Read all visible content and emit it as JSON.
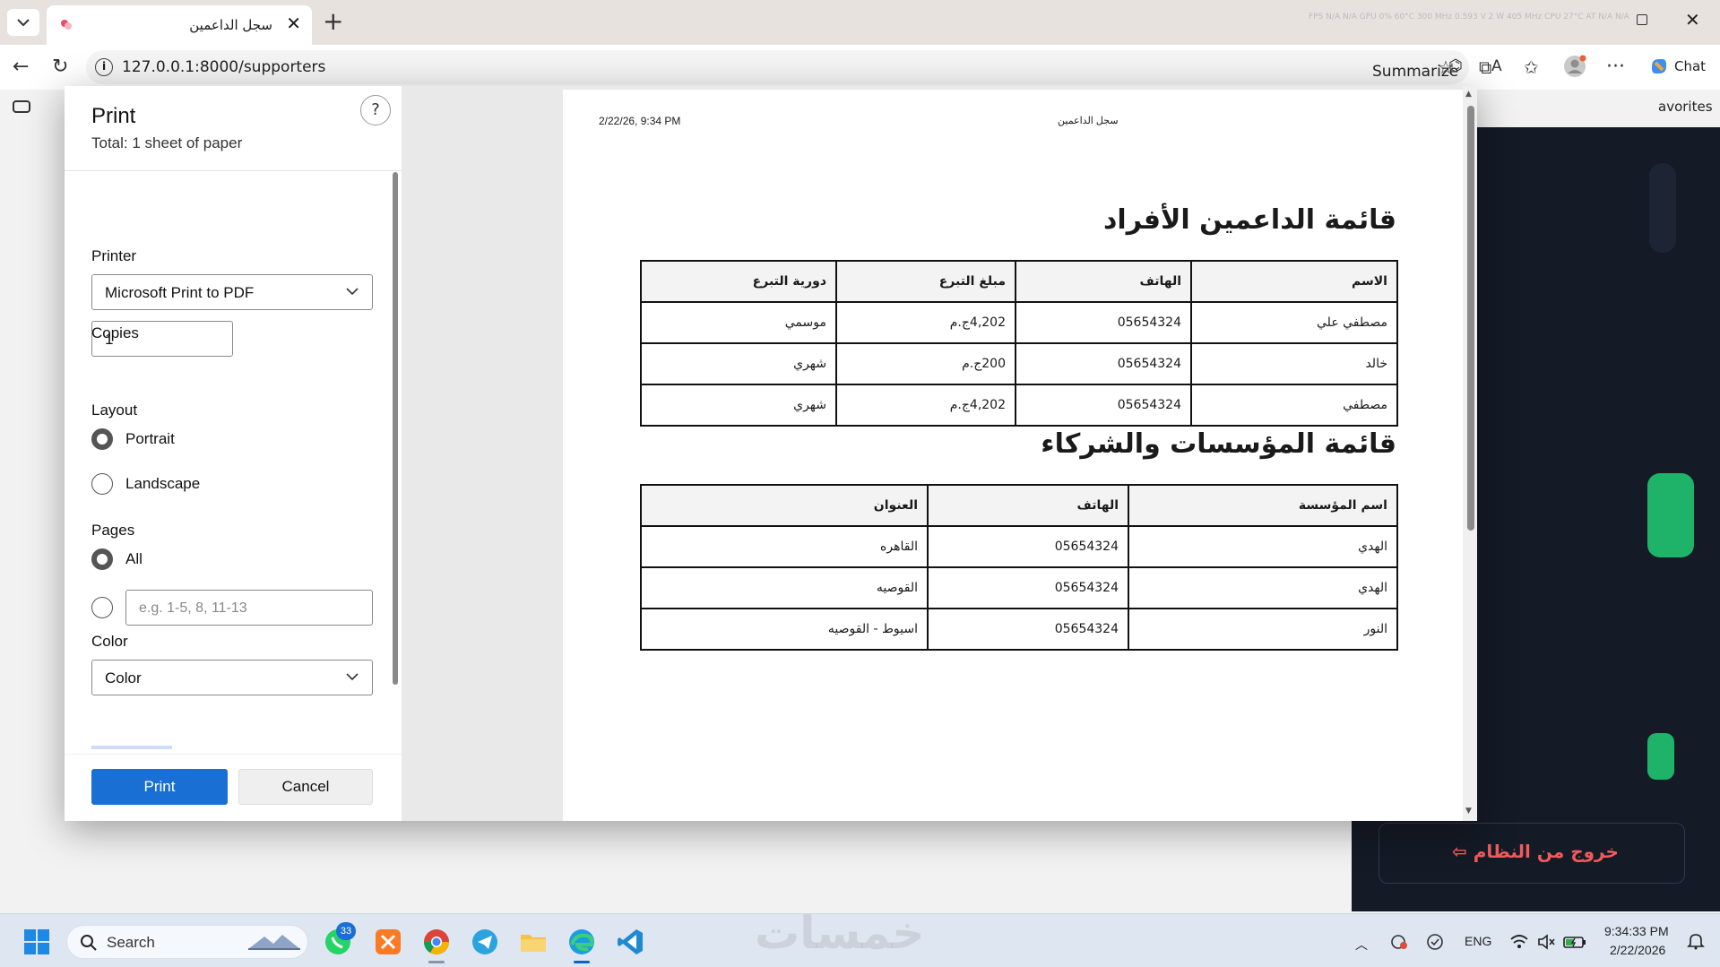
{
  "browser": {
    "tab_title": "سجل الداعمين",
    "url": "127.0.0.1:8000/supporters",
    "summarize_label": "Summarize",
    "chat_label": "Chat",
    "favorites_label": "avorites",
    "sysinfo": "FPS N/A N/A   GPU 0% 60°C 300 MHz 0.593 V 2 W 405 MHz   CPU 27°C AT N/A N/A"
  },
  "background_page": {
    "logout_label": "خروج من النظام ⇦"
  },
  "print_panel": {
    "title": "Print",
    "total": "Total: 1 sheet of paper",
    "help": "?",
    "printer_label": "Printer",
    "printer_value": "Microsoft Print to PDF",
    "copies_label": "Copies",
    "copies_value": "1",
    "layout_label": "Layout",
    "layout_options": [
      "Portrait",
      "Landscape"
    ],
    "layout_selected": "Portrait",
    "pages_label": "Pages",
    "pages_all": "All",
    "pages_custom_placeholder": "e.g. 1-5, 8, 11-13",
    "color_label": "Color",
    "color_value": "Color",
    "print_button": "Print",
    "cancel_button": "Cancel"
  },
  "preview": {
    "header_date": "2/22/26, 9:34 PM",
    "header_title": "سجل الداعمين",
    "individuals": {
      "heading": "قائمة الداعمين الأفراد",
      "columns": [
        "الاسم",
        "الهاتف",
        "مبلغ التبرع",
        "دورية التبرع"
      ],
      "rows": [
        [
          "مصطفي علي",
          "05654324",
          "4,202ج.م",
          "موسمي"
        ],
        [
          "خالد",
          "05654324",
          "200ج.م",
          "شهري"
        ],
        [
          "مصطفي",
          "05654324",
          "4,202ج.م",
          "شهري"
        ]
      ]
    },
    "institutions": {
      "heading": "قائمة المؤسسات والشركاء",
      "columns": [
        "اسم المؤسسة",
        "الهاتف",
        "العنوان"
      ],
      "rows": [
        [
          "الهدي",
          "05654324",
          "القاهره"
        ],
        [
          "الهدي",
          "05654324",
          "القوصيه"
        ],
        [
          "النور",
          "05654324",
          "اسيوط - القوصيه"
        ]
      ]
    }
  },
  "taskbar": {
    "search_label": "Search",
    "whatsapp_badge": "33",
    "watermark": "خمسات",
    "language": "ENG",
    "time": "9:34:33 PM",
    "date": "2/22/2026",
    "apps": [
      "whatsapp-icon",
      "xampp-icon",
      "chrome-icon",
      "telegram-icon",
      "file-explorer-icon",
      "edge-icon",
      "vscode-icon"
    ]
  }
}
